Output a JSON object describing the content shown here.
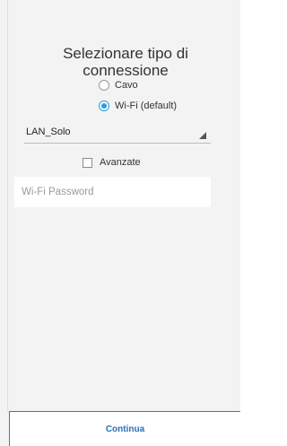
{
  "screen": {
    "title": "Selezionare tipo di connessione"
  },
  "connection_type": {
    "options": [
      {
        "label": "Cavo",
        "selected": false
      },
      {
        "label": "Wi-Fi (default)",
        "selected": true
      }
    ]
  },
  "network": {
    "selected_ssid": "LAN_Solo"
  },
  "advanced": {
    "label": "Avanzate",
    "checked": false
  },
  "password": {
    "placeholder": "Wi-Fi Password",
    "value": ""
  },
  "footer": {
    "continue_label": "Continua"
  },
  "colors": {
    "accent": "#2a9be0",
    "button_text": "#2a6db8",
    "footer_border": "#2e7dd1"
  }
}
